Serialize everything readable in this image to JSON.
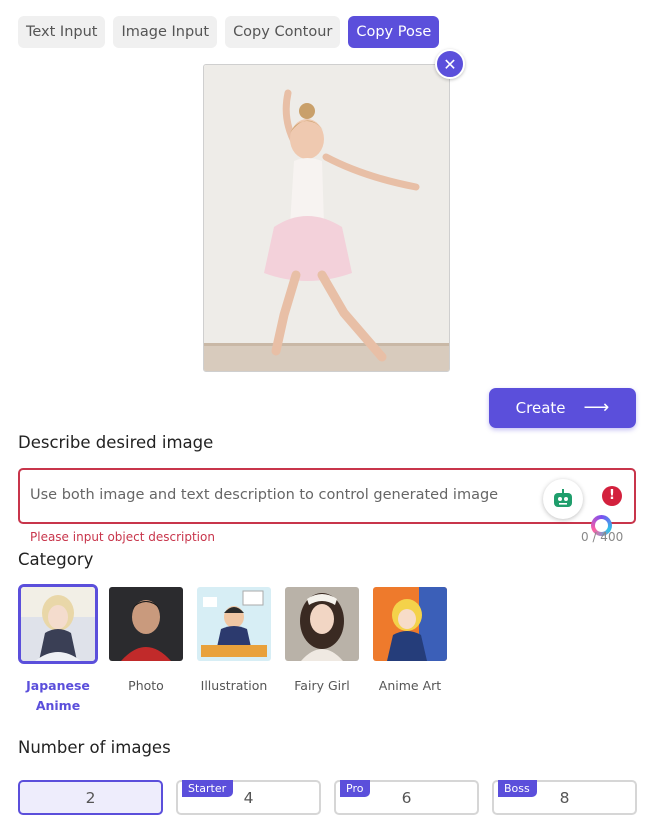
{
  "tabs": [
    {
      "label": "Text Input"
    },
    {
      "label": "Image Input"
    },
    {
      "label": "Copy Contour"
    },
    {
      "label": "Copy Pose",
      "active": true
    }
  ],
  "create_button": {
    "label": "Create",
    "icon": "arrow-right-icon"
  },
  "describe": {
    "title": "Describe desired image",
    "placeholder": "Use both image and text description to control generated image",
    "value": "",
    "error": "Please input object description",
    "counter": "0 / 400"
  },
  "category": {
    "title": "Category",
    "items": [
      {
        "label": "Japanese Anime",
        "selected": true
      },
      {
        "label": "Photo"
      },
      {
        "label": "Illustration"
      },
      {
        "label": "Fairy Girl"
      },
      {
        "label": "Anime Art"
      }
    ]
  },
  "number_of_images": {
    "title": "Number of images",
    "options": [
      {
        "value": "2",
        "badge": "",
        "selected": true
      },
      {
        "value": "4",
        "badge": "Starter"
      },
      {
        "value": "6",
        "badge": "Pro"
      },
      {
        "value": "8",
        "badge": "Boss"
      }
    ]
  },
  "colors": {
    "accent": "#5b4fdb",
    "error": "#c8354b"
  }
}
